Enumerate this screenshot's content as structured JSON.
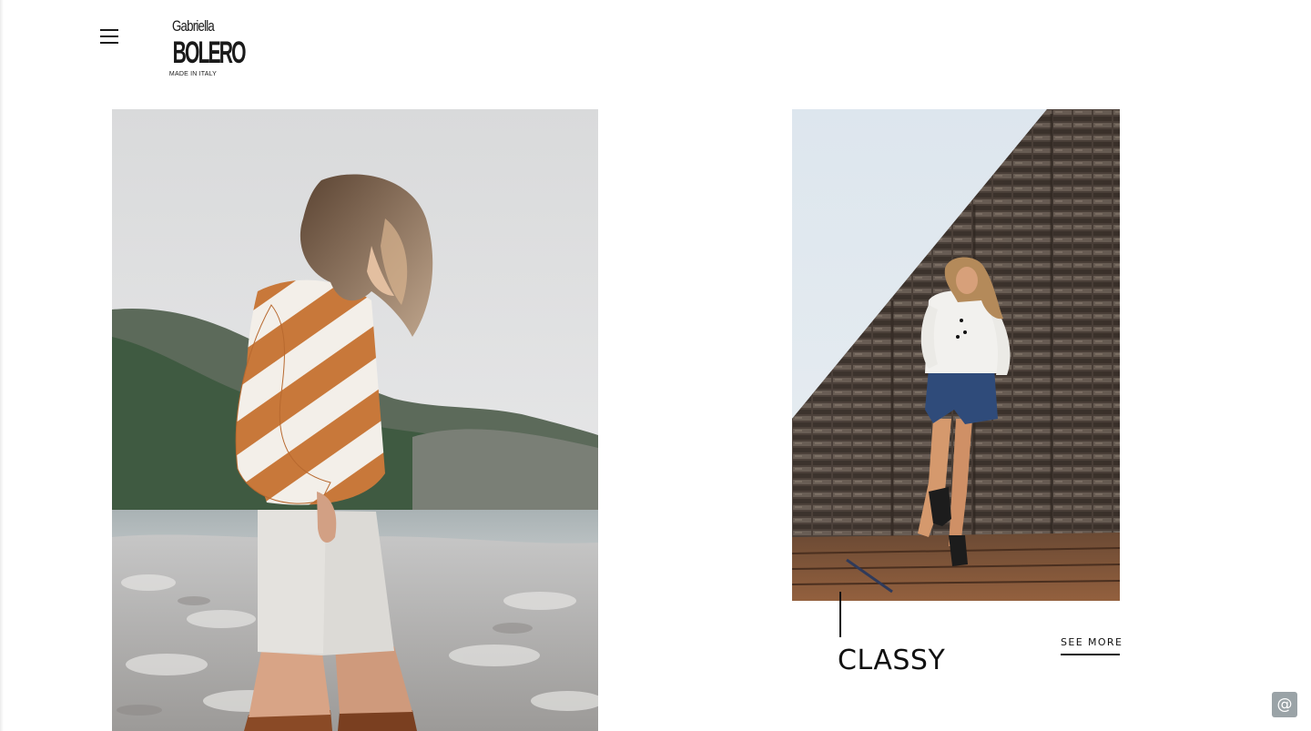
{
  "header": {
    "menu_icon": "hamburger-icon",
    "logo": {
      "script_text": "Gabriella",
      "brand_text": "BOLERO",
      "tagline": "MADE IN ITALY"
    }
  },
  "gallery": {
    "items": [
      {
        "photo": "woman-in-orange-white-chevron-sweater-by-lake"
      },
      {
        "photo": "woman-in-white-blouse-denim-shorts-against-wooden-wall",
        "title": "CLASSY",
        "link_label": "SEE MORE"
      }
    ]
  },
  "contact_widget": {
    "icon": "at-sign-icon",
    "glyph": "@",
    "color": "#9aa3a7"
  },
  "colors": {
    "text": "#111111",
    "background": "#ffffff"
  }
}
